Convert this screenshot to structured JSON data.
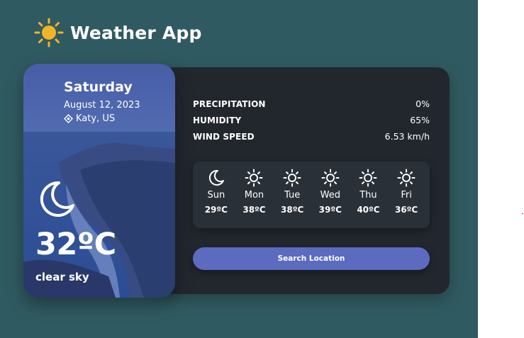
{
  "app": {
    "title": "Weather App",
    "logo_icon": "sun-icon"
  },
  "current": {
    "day": "Saturday",
    "date": "August 12, 2023",
    "location": "Katy, US",
    "location_icon": "location-pin-icon",
    "condition_icon": "moon-icon",
    "temperature": "32ºC",
    "description": "clear sky"
  },
  "stats": [
    {
      "label": "PRECIPITATION",
      "value": "0%"
    },
    {
      "label": "HUMIDITY",
      "value": "65%"
    },
    {
      "label": "WIND SPEED",
      "value": "6.53 km/h"
    }
  ],
  "forecast": [
    {
      "day": "Sun",
      "temp": "29ºC",
      "icon": "moon-icon"
    },
    {
      "day": "Mon",
      "temp": "38ºC",
      "icon": "sun-icon"
    },
    {
      "day": "Tue",
      "temp": "38ºC",
      "icon": "sun-icon"
    },
    {
      "day": "Wed",
      "temp": "39ºC",
      "icon": "sun-icon"
    },
    {
      "day": "Thu",
      "temp": "40ºC",
      "icon": "sun-icon"
    },
    {
      "day": "Fri",
      "temp": "36ºC",
      "icon": "sun-icon"
    }
  ],
  "search_button_label": "Search Location",
  "colors": {
    "background": "#305a61",
    "panel": "#22272e",
    "accent": "#5b6bc0",
    "sun": "#f0b429"
  }
}
